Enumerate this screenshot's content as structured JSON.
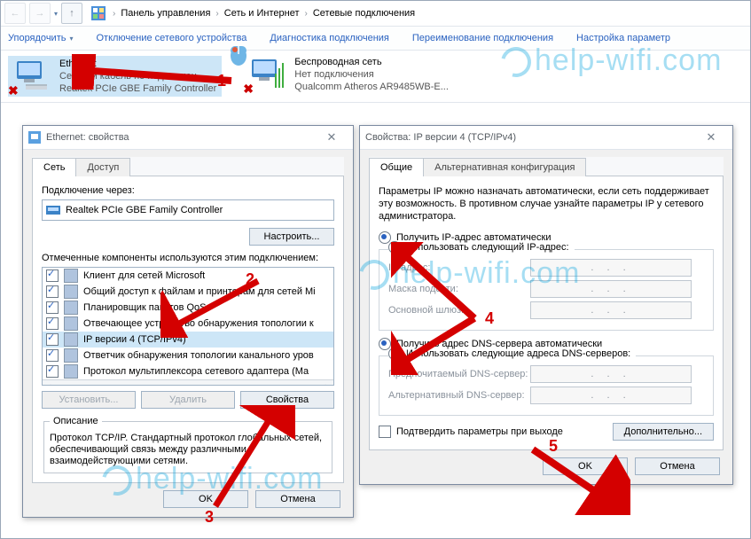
{
  "breadcrumb": {
    "root": "Панель управления",
    "net": "Сеть и Интернет",
    "conns": "Сетевые подключения"
  },
  "toolbar": {
    "organize": "Упорядочить",
    "disable": "Отключение сетевого устройства",
    "diag": "Диагностика подключения",
    "rename": "Переименование подключения",
    "settings": "Настройка параметр"
  },
  "conn1": {
    "name": "Ethernet",
    "status": "Сетевой кабель не подключен",
    "adapter": "Realtek PCIe GBE Family Controller"
  },
  "conn2": {
    "name": "Беспроводная сеть",
    "status": "Нет подключения",
    "adapter": "Qualcomm Atheros AR9485WB-E..."
  },
  "dlg1": {
    "title": "Ethernet: свойства",
    "tab_net": "Сеть",
    "tab_access": "Доступ",
    "conn_via": "Подключение через:",
    "adapter": "Realtek PCIe GBE Family Controller",
    "configure": "Настроить...",
    "comps": "Отмеченные компоненты используются этим подключением:",
    "items": [
      "Клиент для сетей Microsoft",
      "Общий доступ к файлам и принтерам для сетей Mi",
      "Планировщик пакетов QoS",
      "Отвечающее устройство обнаружения топологии к",
      "IP версии 4 (TCP/IPv4)",
      "Ответчик обнаружения топологии канального уров",
      "Протокол мультиплексора сетевого адаптера (Ма"
    ],
    "install": "Установить...",
    "remove": "Удалить",
    "props": "Свойства",
    "desc_t": "Описание",
    "desc": "Протокол TCP/IP. Стандартный протокол глобальных сетей, обеспечивающий связь между различными взаимодействующими сетями.",
    "ok": "OK",
    "cancel": "Отмена"
  },
  "dlg2": {
    "title": "Свойства: IP версии 4 (TCP/IPv4)",
    "tab_gen": "Общие",
    "tab_alt": "Альтернативная конфигурация",
    "para": "Параметры IP можно назначать автоматически, если сеть поддерживает эту возможность. В противном случае узнайте параметры IP у сетевого администратора.",
    "r_ip_auto": "Получить IP-адрес автоматически",
    "r_ip_man": "Использовать следующий IP-адрес:",
    "f_ip": "IP-адрес:",
    "f_mask": "Маска подсети:",
    "f_gw": "Основной шлюз:",
    "r_dns_auto": "Получить адрес DNS-сервера автоматически",
    "r_dns_man": "Использовать следующие адреса DNS-серверов:",
    "f_dns1": "Предпочитаемый DNS-сервер:",
    "f_dns2": "Альтернативный DNS-сервер:",
    "confirm": "Подтвердить параметры при выходе",
    "adv": "Дополнительно...",
    "ok": "OK",
    "cancel": "Отмена",
    "dots": ".   .   ."
  },
  "wm": "help-wifi.com"
}
